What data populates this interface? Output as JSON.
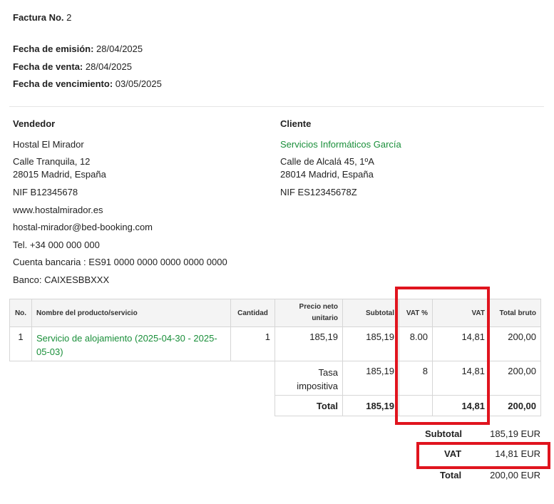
{
  "header": {
    "invoice_label": "Factura No.",
    "invoice_number": "2",
    "issue_label": "Fecha de emisión:",
    "issue_value": "28/04/2025",
    "sale_label": "Fecha de venta:",
    "sale_value": "28/04/2025",
    "due_label": "Fecha de vencimiento:",
    "due_value": "03/05/2025"
  },
  "seller": {
    "title": "Vendedor",
    "name": "Hostal El Mirador",
    "address1": "Calle Tranquila, 12",
    "address2": "28015 Madrid, España",
    "nif": "NIF B12345678",
    "web": "www.hostalmirador.es",
    "email": "hostal-mirador@bed-booking.com",
    "phone": "Tel. +34 000 000 000",
    "bank_account": "Cuenta bancaria : ES91 0000 0000 0000 0000 0000",
    "bank": "Banco: CAIXESBBXXX"
  },
  "client": {
    "title": "Cliente",
    "name": "Servicios Informáticos García",
    "address1": "Calle de Alcalá 45, 1ºA",
    "address2": "28014 Madrid, España",
    "nif": "NIF ES12345678Z"
  },
  "table": {
    "headers": {
      "no": "No.",
      "product": "Nombre del producto/servicio",
      "qty": "Cantidad",
      "net_price": "Precio neto unitario",
      "subtotal": "Subtotal",
      "vat_pct": "VAT %",
      "vat": "VAT",
      "gross": "Total bruto"
    },
    "row": {
      "no": "1",
      "product": "Servicio de alojamiento (2025-04-30 - 2025-05-03)",
      "qty": "1",
      "net_price": "185,19",
      "subtotal": "185,19",
      "vat_pct": "8.00",
      "vat": "14,81",
      "gross": "200,00"
    },
    "tax_row": {
      "label": "Tasa impositiva",
      "subtotal": "185,19",
      "vat_pct": "8",
      "vat": "14,81",
      "gross": "200,00"
    },
    "total_row": {
      "label": "Total",
      "subtotal": "185,19",
      "vat": "14,81",
      "gross": "200,00"
    }
  },
  "summary": {
    "subtotal_label": "Subtotal",
    "subtotal_value": "185,19 EUR",
    "vat_label": "VAT",
    "vat_value": "14,81 EUR",
    "total_label": "Total",
    "total_value": "200,00 EUR"
  },
  "colors": {
    "highlight": "#e0141e",
    "link_green": "#1a8f3a"
  }
}
